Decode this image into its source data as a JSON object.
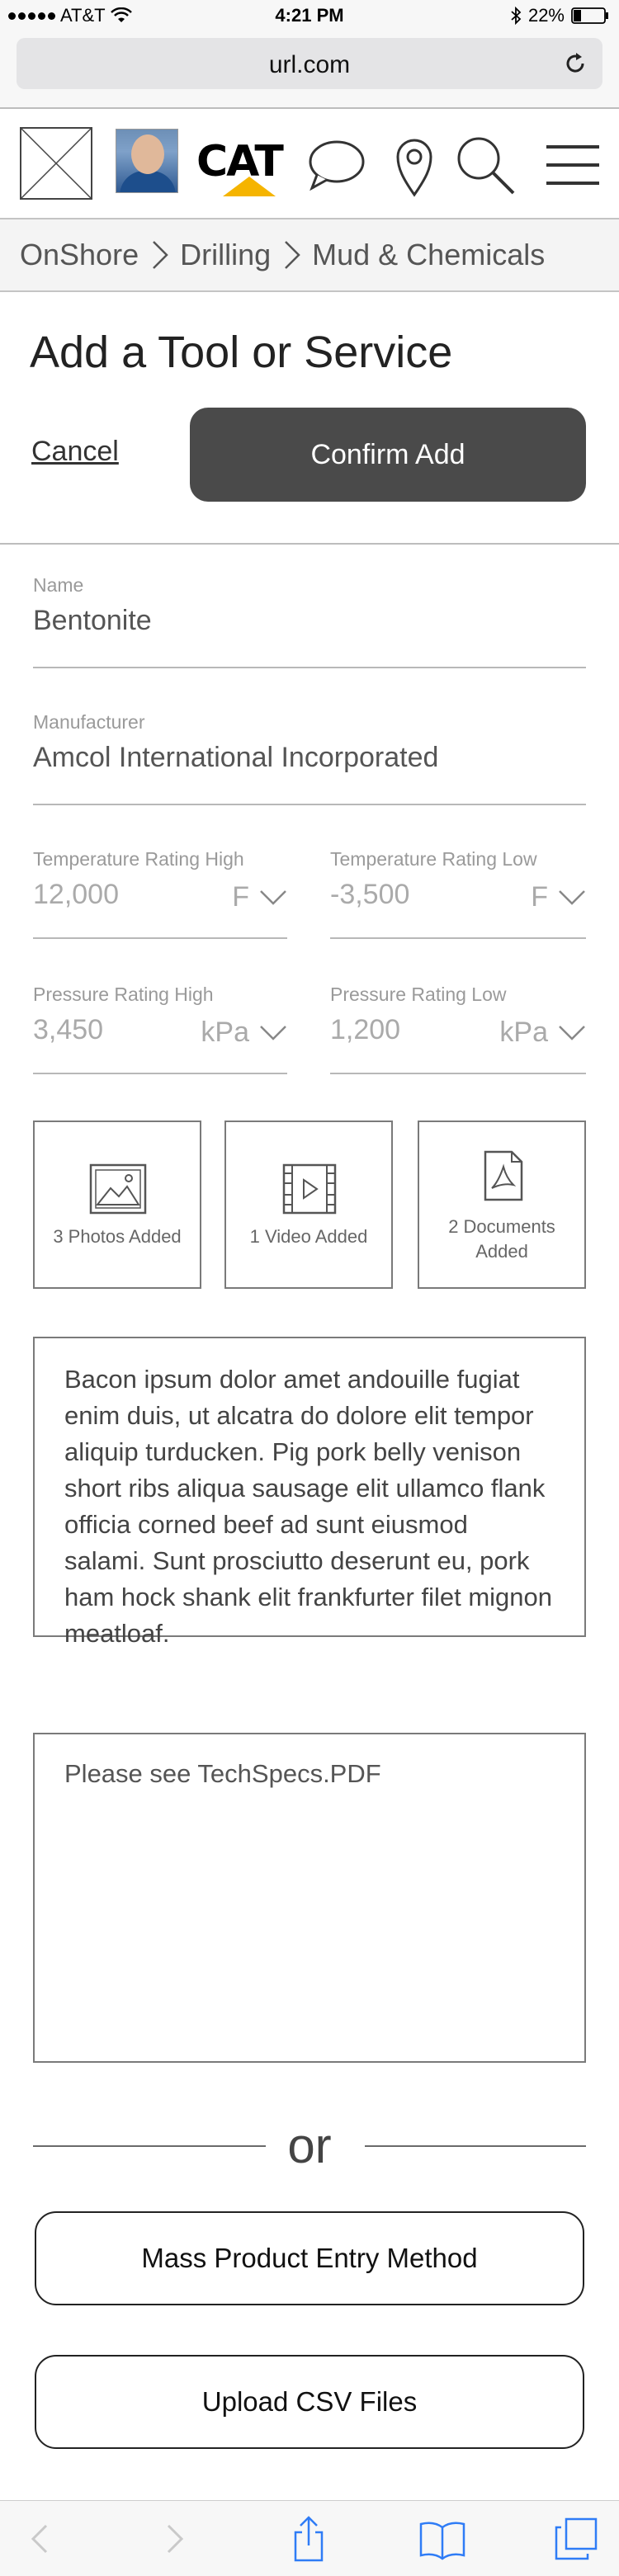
{
  "status_bar": {
    "carrier": "AT&T",
    "time": "4:21 PM",
    "battery": "22%"
  },
  "browser": {
    "url": "url.com"
  },
  "header": {
    "brand": "CAT"
  },
  "breadcrumb": [
    "OnShore",
    "Drilling",
    "Mud & Chemicals"
  ],
  "page": {
    "title": "Add a Tool or Service",
    "cancel_label": "Cancel",
    "confirm_label": "Confirm Add"
  },
  "fields": {
    "name": {
      "label": "Name",
      "value": "Bentonite"
    },
    "manufacturer": {
      "label": "Manufacturer",
      "value": "Amcol International Incorporated"
    },
    "temp_high": {
      "label": "Temperature Rating High",
      "value": "12,000",
      "unit": "F"
    },
    "temp_low": {
      "label": "Temperature Rating Low",
      "value": "-3,500",
      "unit": "F"
    },
    "pressure_high": {
      "label": "Pressure Rating High",
      "value": "3,450",
      "unit": "kPa"
    },
    "pressure_low": {
      "label": "Pressure Rating Low",
      "value": "1,200",
      "unit": "kPa"
    }
  },
  "media": {
    "photos": "3 Photos Added",
    "videos": "1 Video Added",
    "documents": "2 Documents Added"
  },
  "description": "Bacon ipsum dolor amet andouille fugiat enim duis, ut alcatra do dolore elit tempor aliquip turducken. Pig pork belly venison short ribs aliqua sausage elit ullamco flank officia corned beef ad sunt eiusmod salami. Sunt prosciutto deserunt eu, pork ham hock shank elit frankfurter filet mignon meatloaf.",
  "notes": "Please see TechSpecs.PDF",
  "or_label": "or",
  "actions": {
    "mass_entry": "Mass Product Entry Method",
    "upload_csv": "Upload CSV Files"
  },
  "icons": {
    "status": [
      "signal-dots-icon",
      "wifi-icon",
      "bluetooth-icon",
      "battery-icon"
    ],
    "header": [
      "logo-placeholder-icon",
      "chat-icon",
      "location-pin-icon",
      "search-icon",
      "menu-icon"
    ],
    "toolbar": [
      "back-icon",
      "forward-icon",
      "share-icon",
      "bookmarks-icon",
      "tabs-icon"
    ]
  }
}
